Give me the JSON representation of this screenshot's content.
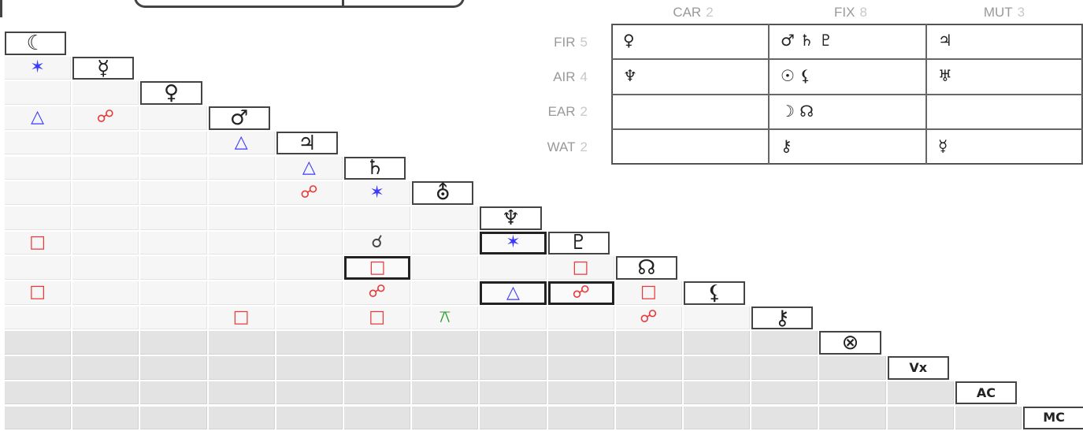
{
  "planets": [
    {
      "name": "moon",
      "glyph": "☾"
    },
    {
      "name": "mercury",
      "glyph": "☿"
    },
    {
      "name": "venus",
      "glyph": "♀"
    },
    {
      "name": "mars",
      "glyph": "♂"
    },
    {
      "name": "jupiter",
      "glyph": "♃"
    },
    {
      "name": "saturn",
      "glyph": "♄"
    },
    {
      "name": "uranus",
      "glyph": "⛢"
    },
    {
      "name": "neptune",
      "glyph": "♆"
    },
    {
      "name": "pluto",
      "glyph": "♇"
    },
    {
      "name": "node",
      "glyph": "☊"
    },
    {
      "name": "lilith",
      "glyph": "⚸"
    },
    {
      "name": "chiron",
      "glyph": "⚷"
    },
    {
      "name": "fortune",
      "glyph": "⊗"
    },
    {
      "name": "vertex",
      "glyph": "Vx"
    },
    {
      "name": "ascendant",
      "glyph": "AC"
    },
    {
      "name": "midheaven",
      "glyph": "MC"
    }
  ],
  "aspect_types": {
    "conjunction": {
      "glyph": "☌",
      "color": "#444444"
    },
    "sextile": {
      "glyph": "✶",
      "color": "#3a3aff"
    },
    "square": {
      "glyph": "□",
      "color": "#e83a3a"
    },
    "trine": {
      "glyph": "△",
      "color": "#3a3aff"
    },
    "opposition": {
      "glyph": "☍",
      "color": "#e83a3a"
    },
    "quincunx": {
      "glyph": "⚻",
      "color": "#2aa02a"
    }
  },
  "aspects": [
    {
      "row": 1,
      "col": 0,
      "type": "sextile"
    },
    {
      "row": 3,
      "col": 0,
      "type": "trine"
    },
    {
      "row": 3,
      "col": 1,
      "type": "opposition"
    },
    {
      "row": 4,
      "col": 3,
      "type": "trine"
    },
    {
      "row": 5,
      "col": 4,
      "type": "trine"
    },
    {
      "row": 6,
      "col": 4,
      "type": "opposition"
    },
    {
      "row": 6,
      "col": 5,
      "type": "sextile"
    },
    {
      "row": 8,
      "col": 0,
      "type": "square"
    },
    {
      "row": 8,
      "col": 5,
      "type": "conjunction"
    },
    {
      "row": 8,
      "col": 7,
      "type": "sextile",
      "boxed": true
    },
    {
      "row": 9,
      "col": 5,
      "type": "square",
      "boxed": true
    },
    {
      "row": 9,
      "col": 8,
      "type": "square"
    },
    {
      "row": 10,
      "col": 0,
      "type": "square"
    },
    {
      "row": 10,
      "col": 5,
      "type": "opposition"
    },
    {
      "row": 10,
      "col": 7,
      "type": "trine",
      "boxed": true
    },
    {
      "row": 10,
      "col": 8,
      "type": "opposition",
      "boxed": true
    },
    {
      "row": 10,
      "col": 9,
      "type": "square"
    },
    {
      "row": 11,
      "col": 3,
      "type": "square"
    },
    {
      "row": 11,
      "col": 5,
      "type": "square"
    },
    {
      "row": 11,
      "col": 6,
      "type": "quincunx"
    },
    {
      "row": 11,
      "col": 9,
      "type": "opposition"
    }
  ],
  "modality": {
    "headers": [
      {
        "label": "CAR",
        "count": "2"
      },
      {
        "label": "FIX",
        "count": "8"
      },
      {
        "label": "MUT",
        "count": "3"
      }
    ],
    "rows": [
      {
        "label": "FIR",
        "count": "5",
        "cells": [
          "♀",
          "♂ ♄ ♇",
          "♃"
        ]
      },
      {
        "label": "AIR",
        "count": "4",
        "cells": [
          "♆",
          "☉ ⚸",
          "♅"
        ]
      },
      {
        "label": "EAR",
        "count": "2",
        "cells": [
          "",
          "☽ ☊",
          ""
        ]
      },
      {
        "label": "WAT",
        "count": "2",
        "cells": [
          "",
          "⚷",
          "☿"
        ]
      }
    ]
  }
}
